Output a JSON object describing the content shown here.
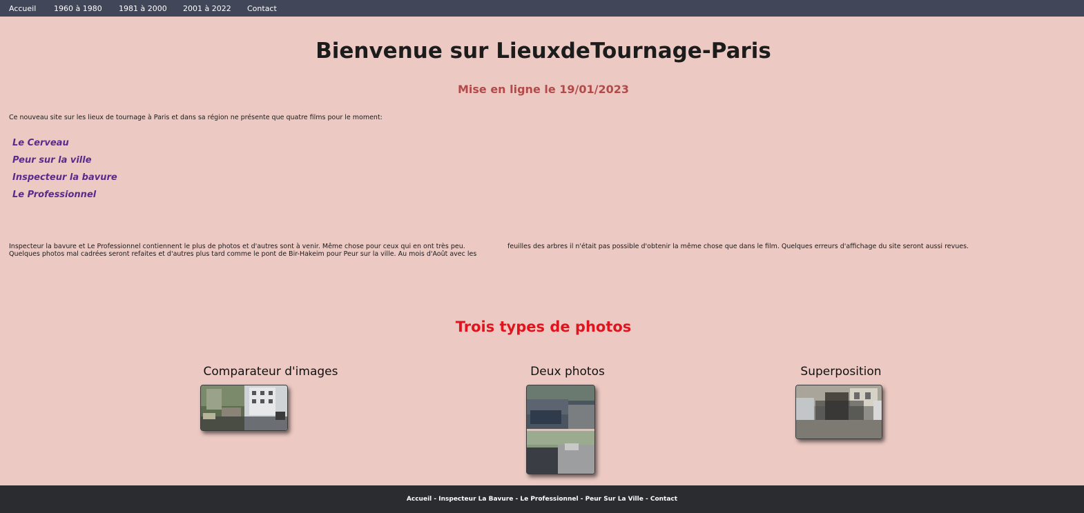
{
  "nav": {
    "items": [
      {
        "label": "Accueil"
      },
      {
        "label": "1960 à 1980"
      },
      {
        "label": "1981 à 2000"
      },
      {
        "label": "2001 à 2022"
      },
      {
        "label": "Contact"
      }
    ]
  },
  "header": {
    "title": "Bienvenue sur LieuxdeTournage-Paris",
    "subtitle": "Mise en ligne le 19/01/2023"
  },
  "intro": "Ce nouveau site sur les lieux de tournage à Paris et dans sa région ne présente que quatre films pour le moment:",
  "films": [
    {
      "label": "Le Cerveau"
    },
    {
      "label": "Peur sur la ville"
    },
    {
      "label": "Inspecteur la bavure"
    },
    {
      "label": "Le Professionnel"
    }
  ],
  "paragraph": "Inspecteur la bavure et Le Professionnel contiennent le plus de photos et d'autres sont à venir. Même chose pour ceux qui en ont très peu. Quelques photos mal cadrées seront refaites et d'autres plus tard comme le pont de Bir-Hakeim pour Peur sur la ville. Au mois d'Août avec les feuilles des arbres il n'était pas possible d'obtenir la même chose que dans le film. Quelques erreurs d'affichage du site seront aussi revues.",
  "photos_section": {
    "title": "Trois types de photos",
    "cards": [
      {
        "title": "Comparateur d'images"
      },
      {
        "title": "Deux photos"
      },
      {
        "title": "Superposition"
      }
    ]
  },
  "footer": {
    "links": [
      {
        "label": "Accueil"
      },
      {
        "label": "Inspecteur La Bavure"
      },
      {
        "label": "Le Professionnel"
      },
      {
        "label": "Peur Sur La Ville"
      },
      {
        "label": "Contact"
      }
    ],
    "separator": " - "
  },
  "colors": {
    "background": "#ecc9c2",
    "nav": "#424659",
    "footer": "#2a2c30",
    "subtitle": "#b34a4a",
    "film_link": "#5a2a8c",
    "section_title": "#e0141e"
  }
}
